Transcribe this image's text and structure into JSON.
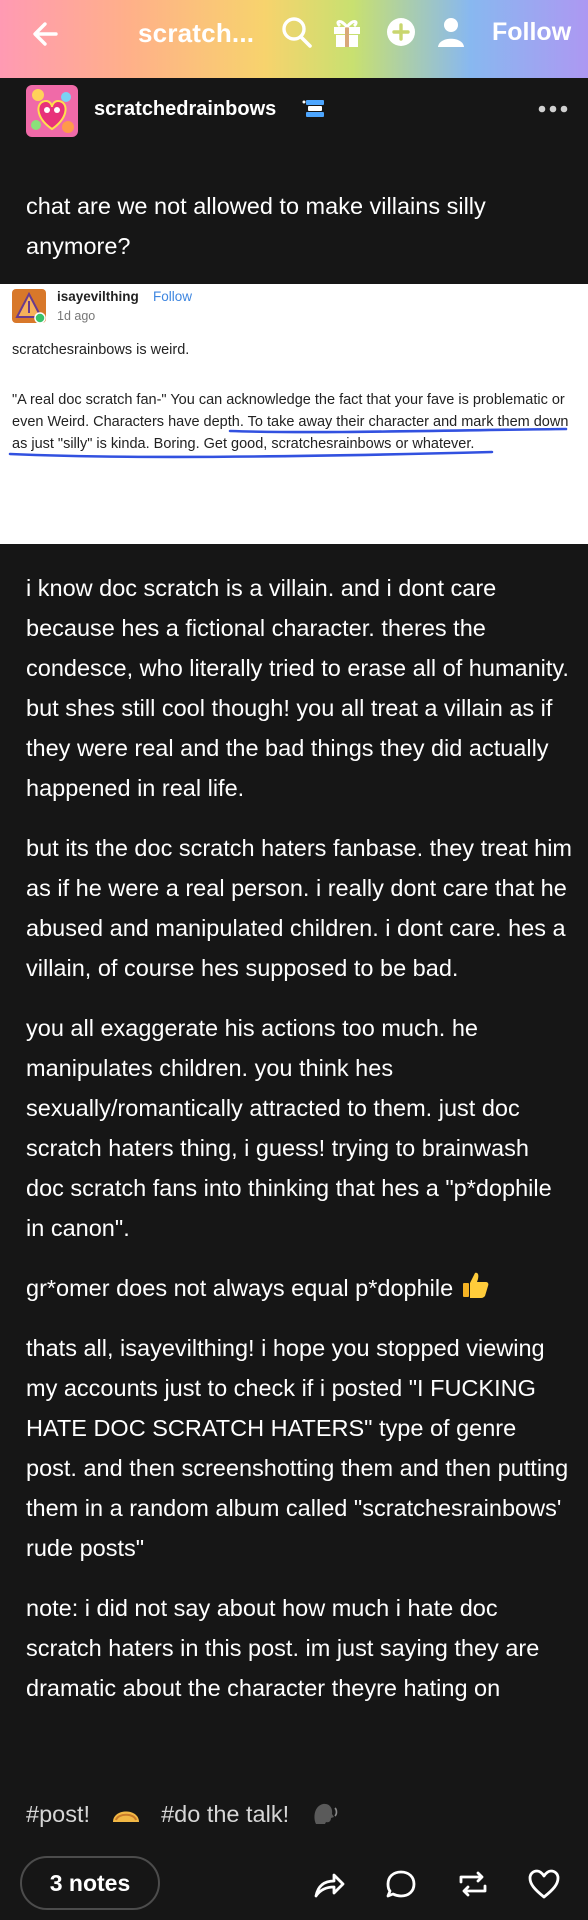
{
  "topbar": {
    "title": "scratch...",
    "follow_label": "Follow",
    "colors": [
      "#ff9ab3",
      "#ffb089",
      "#f7d36d",
      "#c8e070",
      "#88b8f0",
      "#ad98f2"
    ]
  },
  "post": {
    "blog_name": "scratchedrainbows",
    "lead_text": "chat are we not allowed to make villains silly anymore?",
    "screenshot": {
      "name": "isayevilthing",
      "follow": "Follow",
      "ago": "1d ago",
      "line1": "scratchesrainbows is weird.",
      "quote_intro": "\"A real doc scratch fan-\" You can acknowledge the fact that your fave is problematic or even Weird.",
      "quote_underlined": "Characters have depth. To take away their character and mark them down as just \"silly\" is kinda. Boring",
      "quote_outro": ". Get good, scratchesrainbows or whatever."
    },
    "paragraphs": [
      "i know doc scratch is a villain. and i dont care because hes a fictional character. theres the condesce, who literally tried to erase all of humanity. but shes still cool though! you all treat a villain as if they were real and the bad things they did actually happened in real life.",
      "but its the doc scratch haters fanbase. they treat him as if he were a real person. i really dont care that he abused and manipulated children. i dont care. hes a villain, of course hes supposed to be bad.",
      "you all exaggerate his actions too much. he manipulates children. you think hes sexually/romantically attracted to them. just doc scratch haters thing, i guess! trying to brainwash doc scratch fans into thinking that hes a \"p*dophile in canon\".",
      "gr*omer does not always equal p*dophile",
      "thats all, isayevilthing! i hope you stopped viewing my accounts just to check if i posted \"I FUCKING HATE DOC SCRATCH HATERS\" type of genre post. and then screenshotting them and then putting them in a random album called \"scratchesrainbows' rude posts\"",
      "note: i did not say about how much i hate doc scratch haters in this post. im just saying they are dramatic about the character theyre hating on"
    ],
    "tags": [
      "#post!",
      "#do the talk!"
    ],
    "notes": "3 notes"
  },
  "icons": {
    "back": "back-arrow-icon",
    "search": "search-icon",
    "gift": "gift-icon",
    "add": "plus-circle-icon",
    "profile": "person-icon",
    "more": "more-dots-icon",
    "share": "share-icon",
    "reply": "reply-icon",
    "reblog": "reblog-icon",
    "like": "heart-icon"
  }
}
